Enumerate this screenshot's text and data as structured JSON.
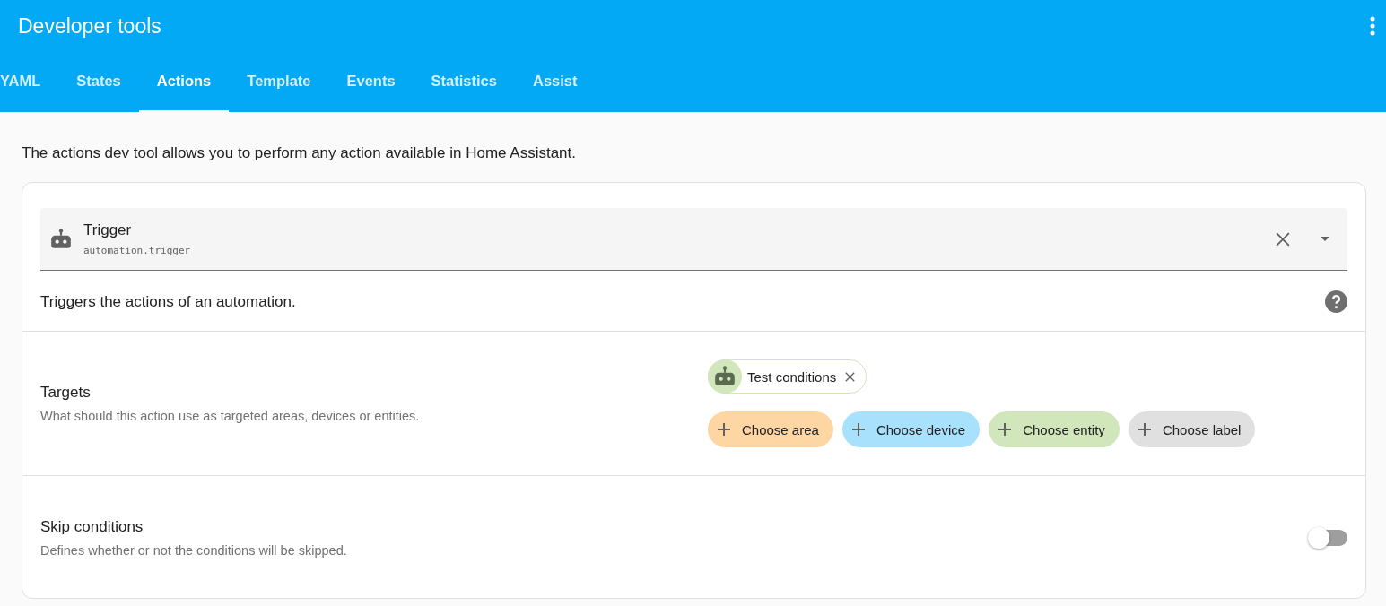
{
  "header": {
    "title": "Developer tools"
  },
  "tabs": [
    {
      "label": "YAML",
      "selected": false
    },
    {
      "label": "States",
      "selected": false
    },
    {
      "label": "Actions",
      "selected": true
    },
    {
      "label": "Template",
      "selected": false
    },
    {
      "label": "Events",
      "selected": false
    },
    {
      "label": "Statistics",
      "selected": false
    },
    {
      "label": "Assist",
      "selected": false
    }
  ],
  "intro": "The actions dev tool allows you to perform any action available in Home Assistant.",
  "action_picker": {
    "name": "Trigger",
    "id": "automation.trigger"
  },
  "action_description": "Triggers the actions of an automation.",
  "targets": {
    "title": "Targets",
    "description": "What should this action use as targeted areas, devices or entities.",
    "selected": [
      {
        "label": "Test conditions",
        "color": "#d1e7bb"
      }
    ],
    "add_buttons": [
      {
        "label": "Choose area",
        "color": "#fed6a4"
      },
      {
        "label": "Choose device",
        "color": "#a8e1fb"
      },
      {
        "label": "Choose entity",
        "color": "#d1e7bb"
      },
      {
        "label": "Choose label",
        "color": "#e0e0e0"
      }
    ]
  },
  "skip_conditions": {
    "title": "Skip conditions",
    "description": "Defines whether or not the conditions will be skipped.",
    "on": false
  }
}
